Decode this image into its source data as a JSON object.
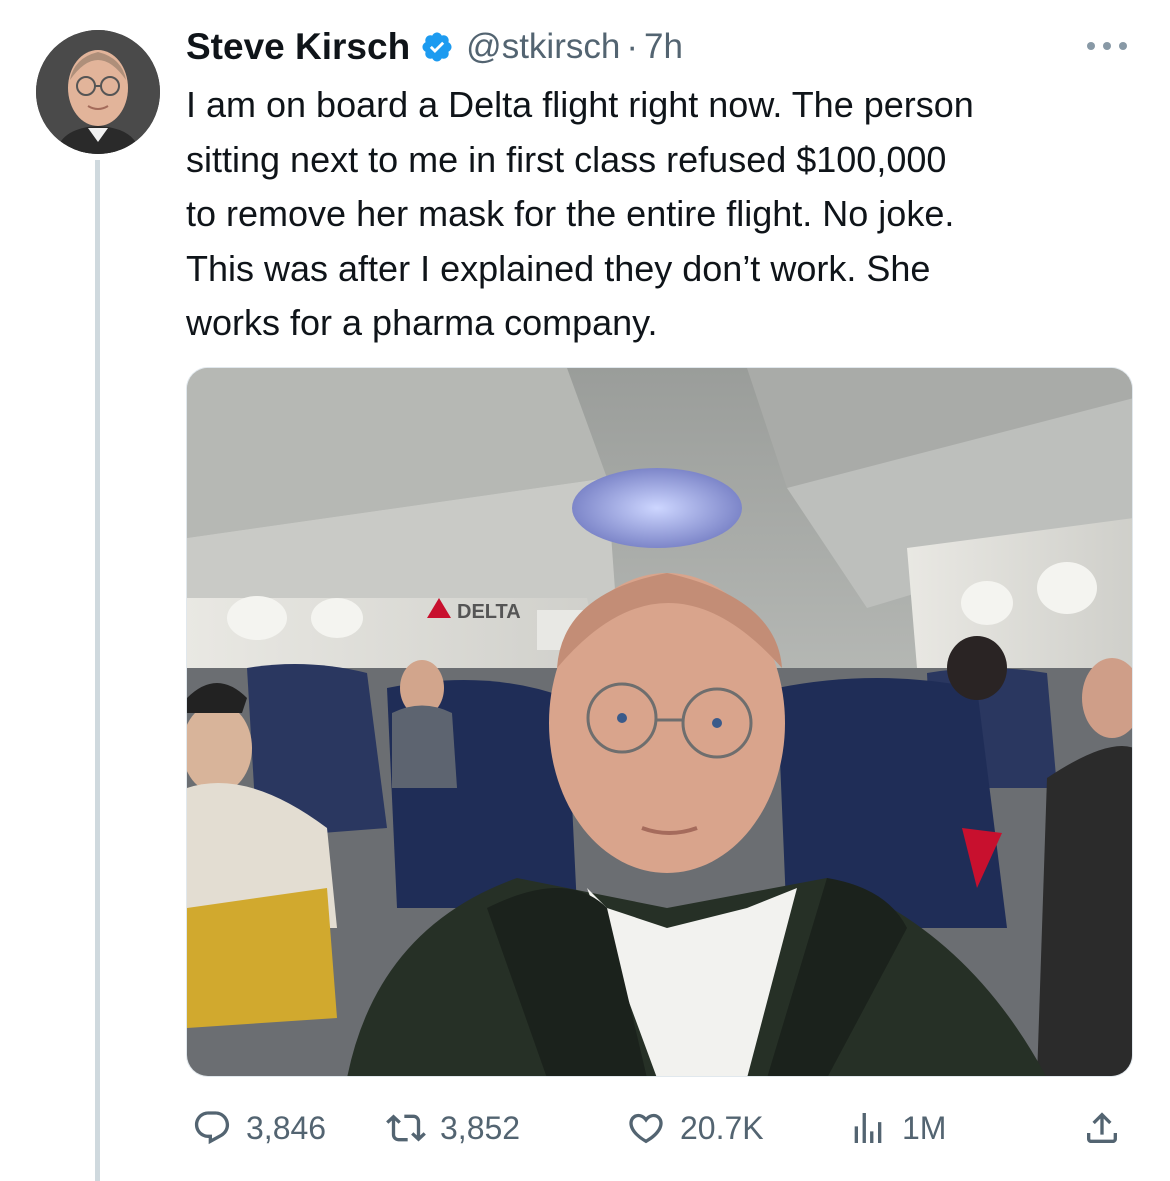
{
  "tweet": {
    "author_name": "Steve Kirsch",
    "handle": "@stkirsch",
    "separator": "·",
    "time": "7h",
    "text": "I am on board a Delta flight right now. The person\nsitting next to me in first class refused $100,000\nto remove her mask for the entire flight. No joke.\nThis was after I explained they don’t work. She\nworks for a pharma company.",
    "media": {
      "sign_text": "DELTA"
    }
  },
  "actions": {
    "replies": "3,846",
    "reposts": "3,852",
    "likes": "20.7K",
    "views": "1M"
  },
  "icons": [
    "verified-badge-icon",
    "more-icon",
    "reply-icon",
    "repost-icon",
    "like-icon",
    "views-icon",
    "share-icon"
  ],
  "colors": {
    "verified": "#1d9bf0",
    "secondary_text": "#536471",
    "thread_line": "#cfd9de"
  }
}
